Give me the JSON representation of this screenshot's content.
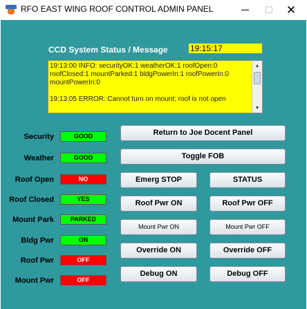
{
  "window": {
    "title": "RFO EAST WING ROOF CONTROL ADMIN PANEL",
    "minimize_glyph": "—",
    "maximize_glyph": "☐",
    "close_glyph": "✕"
  },
  "status": {
    "label": "CCD System Status / Message",
    "time": "19:15:17",
    "log": "19:13:00 INFO: securityOK:1 weatherOK:1 roofOpen:0 roofClosed:1 mountParked:1 bldgPowerIn:1 roofPowerIn:0 mountPowerIn:0\n\n19:13:05 ERROR: Cannot turn on mount: roof is not open"
  },
  "indicators": [
    {
      "label": "Security",
      "value": "GOOD",
      "color": "#00ff00"
    },
    {
      "label": "Weather",
      "value": "GOOD",
      "color": "#00ff00"
    },
    {
      "label": "Roof Open",
      "value": "NO",
      "color": "#ff0000"
    },
    {
      "label": "Roof Closed",
      "value": "YES",
      "color": "#00ff00"
    },
    {
      "label": "Mount Park",
      "value": "PARKED",
      "color": "#00ff00"
    },
    {
      "label": "Bldg Pwr",
      "value": "ON",
      "color": "#00ff00"
    },
    {
      "label": "Roof Pwr",
      "value": "OFF",
      "color": "#ff0000"
    },
    {
      "label": "Mount Pwr",
      "value": "OFF",
      "color": "#ff0000"
    }
  ],
  "buttons": {
    "return_docent": "Return to Joe Docent Panel",
    "toggle_fob": "Toggle FOB",
    "emerg_stop": "Emerg STOP",
    "status": "STATUS",
    "roof_pwr_on": "Roof Pwr ON",
    "roof_pwr_off": "Roof Pwr OFF",
    "mount_pwr_on": "Mount Pwr ON",
    "mount_pwr_off": "Mount Pwr OFF",
    "override_on": "Override ON",
    "override_off": "Override OFF",
    "debug_on": "Debug ON",
    "debug_off": "Debug OFF"
  },
  "colors": {
    "panel_background": "#2f999e",
    "status_yellow": "#ffff00",
    "good_green": "#00ff00",
    "bad_red": "#ff0000"
  },
  "icons": {
    "app": "java-cup-icon",
    "scroll_up": "scroll-up-arrow-icon",
    "scroll_down": "scroll-down-arrow-icon"
  }
}
